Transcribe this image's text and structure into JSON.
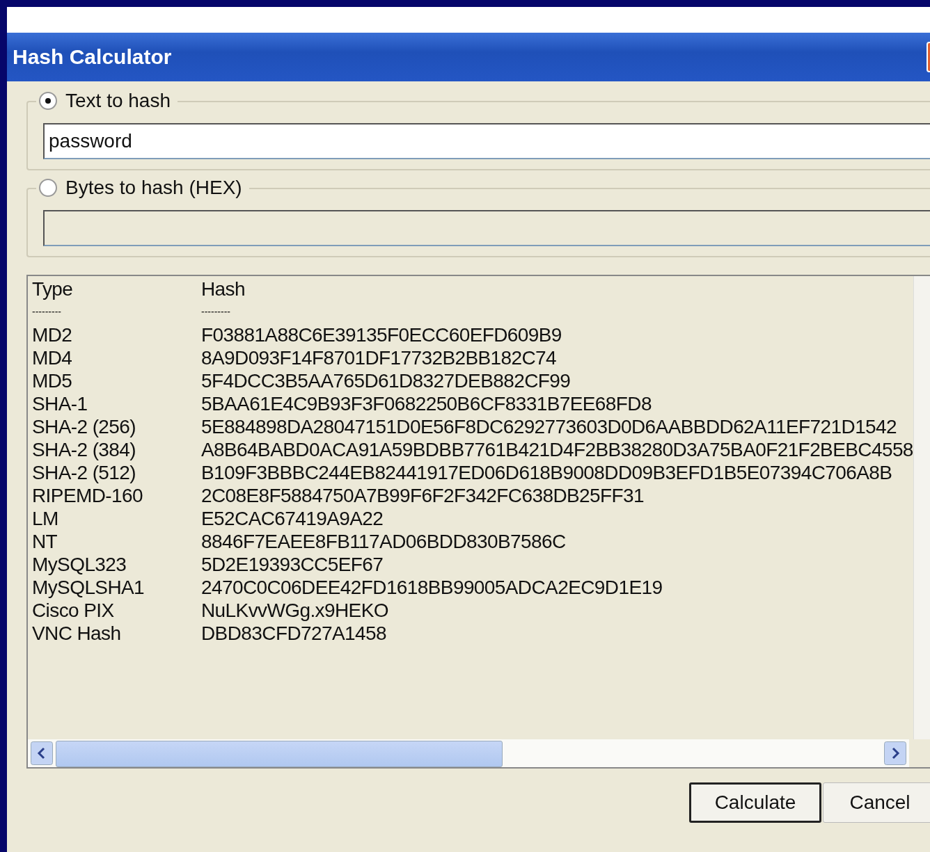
{
  "window": {
    "title": "Hash Calculator"
  },
  "inputs": [
    {
      "label": "Text to hash",
      "selected": true,
      "disabled": false,
      "value": "password"
    },
    {
      "label": "Bytes to hash (HEX)",
      "selected": false,
      "disabled": true
    }
  ],
  "table": {
    "columns": [
      "Type",
      "Hash"
    ],
    "separators": [
      "---------",
      "---------"
    ],
    "rows": [
      {
        "type": "MD2",
        "hash": "F03881A88C6E39135F0ECC60EFD609B9"
      },
      {
        "type": "MD4",
        "hash": "8A9D093F14F8701DF17732B2BB182C74"
      },
      {
        "type": "MD5",
        "hash": "5F4DCC3B5AA765D61D8327DEB882CF99"
      },
      {
        "type": "SHA-1",
        "hash": "5BAA61E4C9B93F3F0682250B6CF8331B7EE68FD8"
      },
      {
        "type": "SHA-2 (256)",
        "hash": "5E884898DA28047151D0E56F8DC6292773603D0D6AABBDD62A11EF721D1542"
      },
      {
        "type": "SHA-2 (384)",
        "hash": "A8B64BABD0ACA91A59BDBB7761B421D4F2BB38280D3A75BA0F21F2BEBC4558"
      },
      {
        "type": "SHA-2 (512)",
        "hash": "B109F3BBBC244EB82441917ED06D618B9008DD09B3EFD1B5E07394C706A8B"
      },
      {
        "type": "RIPEMD-160",
        "hash": "2C08E8F5884750A7B99F6F2F342FC638DB25FF31"
      },
      {
        "type": "LM",
        "hash": "E52CAC67419A9A22"
      },
      {
        "type": "NT",
        "hash": "8846F7EAEE8FB117AD06BDD830B7586C"
      },
      {
        "type": "MySQL323",
        "hash": "5D2E19393CC5EF67"
      },
      {
        "type": "MySQLSHA1",
        "hash": "2470C0C06DEE42FD1618BB99005ADCA2EC9D1E19"
      },
      {
        "type": "Cisco PIX",
        "hash": "NuLKvvWGg.x9HEKO"
      },
      {
        "type": "VNC Hash",
        "hash": "DBD83CFD727A1458"
      }
    ]
  },
  "buttons": [
    {
      "label": "Calculate",
      "default": true
    },
    {
      "label": "Cancel",
      "default": false
    }
  ]
}
